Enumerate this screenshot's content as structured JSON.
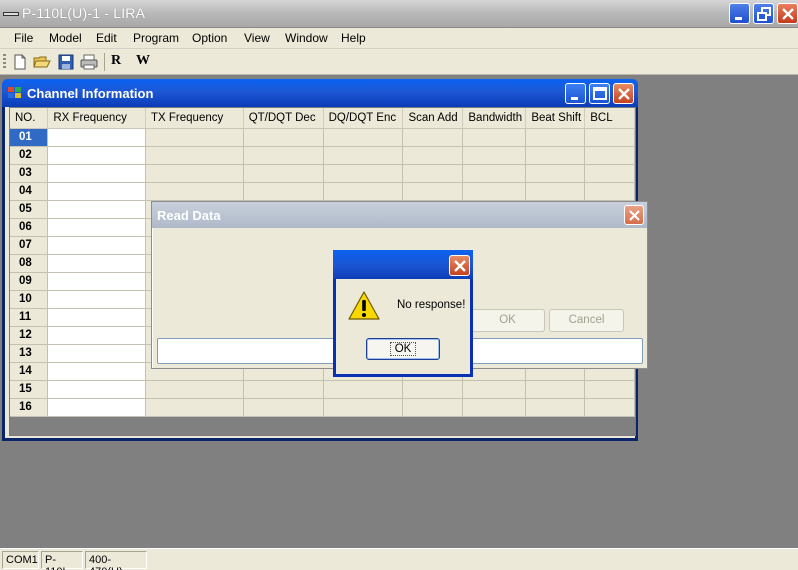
{
  "app": {
    "title": "P-110L(U)-1 - LIRA"
  },
  "menu": [
    "File",
    "Model",
    "Edit",
    "Program",
    "Option",
    "View",
    "Window",
    "Help"
  ],
  "toolbar": {
    "read_label": "R",
    "write_label": "W"
  },
  "child_window": {
    "title": "Channel Information",
    "columns": [
      "NO.",
      "RX Frequency",
      "TX Frequency",
      "QT/DQT Dec",
      "DQ/DQT Enc",
      "Scan Add",
      "Bandwidth",
      "Beat Shift",
      "BCL"
    ],
    "rows": [
      "01",
      "02",
      "03",
      "04",
      "05",
      "06",
      "07",
      "08",
      "09",
      "10",
      "11",
      "12",
      "13",
      "14",
      "15",
      "16"
    ],
    "selected_row": "01"
  },
  "read_dialog": {
    "title": "Read Data",
    "ok_label": "OK",
    "cancel_label": "Cancel"
  },
  "message_box": {
    "message": "No response!",
    "ok_label": "OK"
  },
  "status": [
    "COM1",
    "P-110L",
    "400-470(U)"
  ],
  "colors": {
    "title_blue": "#0a5ff0",
    "selection": "#316ac5",
    "face": "#ece9d8",
    "workspace": "#808080"
  }
}
